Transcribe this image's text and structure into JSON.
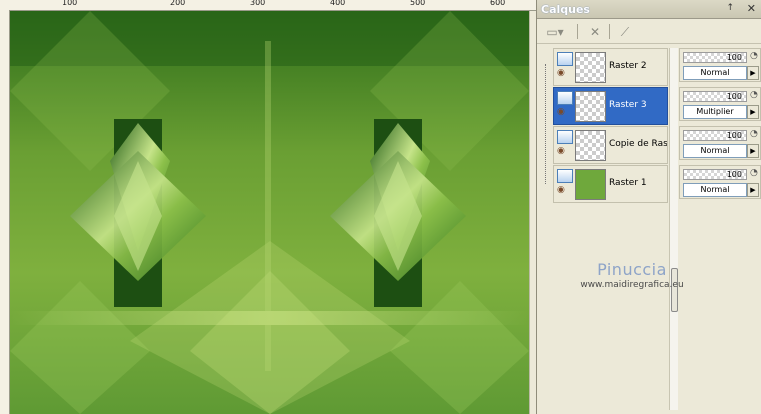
{
  "ruler": {
    "labels": [
      "100",
      "200",
      "300",
      "400",
      "500",
      "600"
    ]
  },
  "panel": {
    "title": "Calques",
    "pin": "↑",
    "close": "✕"
  },
  "toolbar": {
    "buttons": [
      "new-layer-icon",
      "delete-layer-icon",
      "mask-icon"
    ]
  },
  "layers": [
    {
      "name": "Raster 2",
      "selected": false,
      "opacity": "100",
      "mode": "Normal"
    },
    {
      "name": "Raster 3",
      "selected": true,
      "opacity": "100",
      "mode": "Multiplier"
    },
    {
      "name": "Copie de Rast",
      "selected": false,
      "opacity": "100",
      "mode": "Normal"
    },
    {
      "name": "Raster 1",
      "selected": false,
      "opacity": "100",
      "mode": "Normal"
    }
  ],
  "watermark": {
    "title": "Pinuccia",
    "url": "www.maidiregrafica.eu"
  },
  "colors": {
    "selection": "#316ac5",
    "canvas_dark": "#2f6e1a",
    "canvas_light": "#c8e07a"
  }
}
